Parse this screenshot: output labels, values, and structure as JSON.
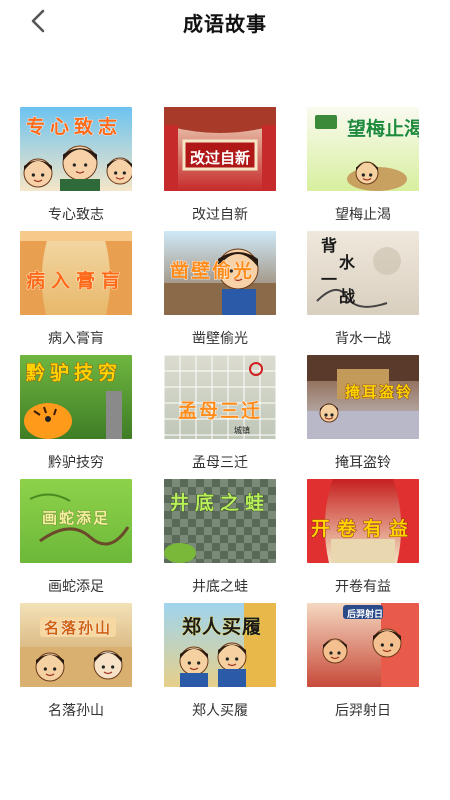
{
  "header": {
    "title": "成语故事",
    "back_icon": "chevron-left-icon"
  },
  "stories": [
    {
      "name": "专心致志",
      "art": "专心致志",
      "scheme": "bluesky"
    },
    {
      "name": "改过自新",
      "art": "改过自新",
      "scheme": "redstage"
    },
    {
      "name": "望梅止渴",
      "art": "望梅止渴",
      "scheme": "greenlight"
    },
    {
      "name": "病入膏肓",
      "art": "病入膏肓",
      "scheme": "curtain"
    },
    {
      "name": "凿壁偷光",
      "art": "凿壁偷光",
      "scheme": "wallblue"
    },
    {
      "name": "背水一战",
      "art": "背水一战",
      "scheme": "ink"
    },
    {
      "name": "黔驴技穷",
      "art": "黔驴技穷",
      "scheme": "forest"
    },
    {
      "name": "孟母三迁",
      "art": "孟母三迁",
      "scheme": "map"
    },
    {
      "name": "掩耳盗铃",
      "art": "掩耳盗铃",
      "scheme": "street"
    },
    {
      "name": "画蛇添足",
      "art": "画蛇添足",
      "scheme": "greenfield"
    },
    {
      "name": "井底之蛙",
      "art": "井底之蛙",
      "scheme": "well"
    },
    {
      "name": "开卷有益",
      "art": "开卷有益",
      "scheme": "redcurtain"
    },
    {
      "name": "名落孙山",
      "art": "名落孙山",
      "scheme": "house"
    },
    {
      "name": "郑人买履",
      "art": "郑人买履",
      "scheme": "market"
    },
    {
      "name": "后羿射日",
      "art": "后羿射日",
      "scheme": "hero"
    }
  ]
}
